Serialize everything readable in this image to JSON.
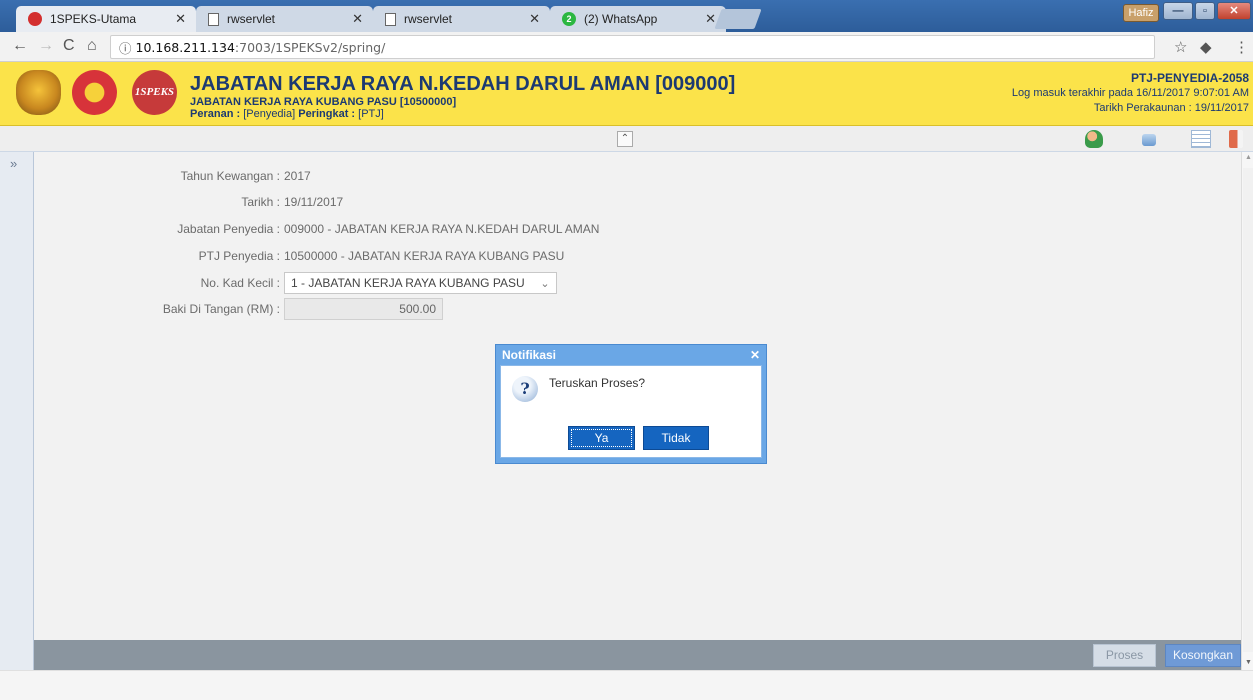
{
  "browser": {
    "tabs": [
      {
        "title": "1SPEKS-Utama",
        "active": true
      },
      {
        "title": "rwservlet",
        "active": false
      },
      {
        "title": "rwservlet",
        "active": false
      },
      {
        "title": "(2) WhatsApp",
        "active": false
      }
    ],
    "whatsapp_badge": "2",
    "window_user": "Hafiz",
    "url_info_icon": "ⓘ",
    "url_host": "10.168.211.134",
    "url_path": ":7003/1SPEKSv2/spring/"
  },
  "header": {
    "title": "JABATAN KERJA RAYA N.KEDAH DARUL AMAN [009000]",
    "subtitle": "JABATAN KERJA RAYA KUBANG PASU [10500000]",
    "role_label": "Peranan : ",
    "role_value": "[Penyedia]",
    "level_label": " Peringkat : ",
    "level_value": "[PTJ]",
    "user": "PTJ-PENYEDIA-2058",
    "last_login": "Log masuk terakhir pada 16/11/2017 9:07:01 AM",
    "account_date": "Tarikh Perakaunan : 19/11/2017",
    "logo_text": "1SPEKS"
  },
  "form": {
    "tahun_label": "Tahun Kewangan :",
    "tahun_value": "2017",
    "tarikh_label": "Tarikh :",
    "tarikh_value": "19/11/2017",
    "jabatan_label": "Jabatan Penyedia :",
    "jabatan_value": "009000 - JABATAN KERJA RAYA N.KEDAH DARUL AMAN",
    "ptj_label": "PTJ Penyedia :",
    "ptj_value": "10500000 - JABATAN KERJA RAYA KUBANG PASU",
    "kad_label": "No. Kad Kecil :",
    "kad_value": "1 - JABATAN KERJA RAYA KUBANG PASU",
    "baki_label": "Baki Di Tangan (RM) :",
    "baki_value": "500.00"
  },
  "footer": {
    "proses_label": "Proses",
    "kosongkan_label": "Kosongkan"
  },
  "dialog": {
    "title": "Notifikasi",
    "message": "Teruskan Proses?",
    "yes_label": "Ya",
    "no_label": "Tidak",
    "icon_glyph": "?"
  },
  "icons": {
    "collapse": "collapse-up-icon",
    "expand": "expand-right-icon",
    "profile": "user-profile-icon",
    "lock": "lock-icon",
    "list": "list-icon",
    "logout": "logout-icon"
  },
  "colors": {
    "header_bg": "#fbe34a",
    "header_text": "#1c3a72",
    "dialog_frame": "#6aa7e6",
    "primary_button": "#1565c0"
  }
}
